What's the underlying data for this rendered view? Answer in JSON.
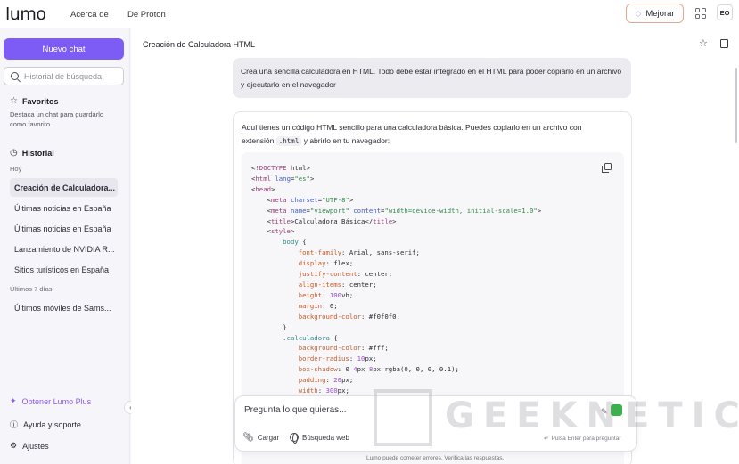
{
  "header": {
    "logo": "lumo",
    "nav": [
      "Acerca de",
      "De Proton"
    ],
    "upgrade_label": "Mejorar",
    "avatar_initials": "EO"
  },
  "sidebar": {
    "new_chat_label": "Nuevo chat",
    "search_placeholder": "Historial de búsqueda",
    "favorites_title": "Favoritos",
    "favorites_desc": "Destaca un chat para guardarlo como favorito.",
    "history_title": "Historial",
    "groups": [
      {
        "label": "Hoy",
        "items": [
          "Creación de Calculadora...",
          "Últimas noticias en España",
          "Últimas noticias en España",
          "Lanzamiento de NVIDIA R...",
          "Sitios turísticos en España"
        ]
      },
      {
        "label": "Últimos 7 días",
        "items": [
          "Últimos móviles de Sams..."
        ]
      }
    ],
    "footer": {
      "plus_label": "Obtener Lumo Plus",
      "help_label": "Ayuda y soporte",
      "settings_label": "Ajustes"
    }
  },
  "chat": {
    "title": "Creación de Calculadora HTML",
    "user_message": "Crea una sencilla calculadora en HTML. Todo debe estar integrado en el HTML para poder copiarlo en un archivo y ejecutarlo en el navegador",
    "bot_intro_before": "Aquí tienes un código HTML sencillo para una calculadora básica. Puedes copiarlo en un archivo con extensión",
    "bot_intro_code": ".html",
    "bot_intro_after": "y abrirlo en tu navegador:",
    "code_lines": [
      "<!DOCTYPE html>",
      "<html lang=\"es\">",
      "<head>",
      "    <meta charset=\"UTF-8\">",
      "    <meta name=\"viewport\" content=\"width=device-width, initial-scale=1.0\">",
      "    <title>Calculadora Básica</title>",
      "    <style>",
      "        body {",
      "            font-family: Arial, sans-serif;",
      "            display: flex;",
      "            justify-content: center;",
      "            align-items: center;",
      "            height: 100vh;",
      "            margin: 0;",
      "            background-color: #f0f0f0;",
      "        }",
      "        .calculadora {",
      "            background-color: #fff;",
      "            border-radius: 10px;",
      "            box-shadow: 0 4px 8px rgba(0, 0, 0, 0.1);",
      "            padding: 20px;",
      "            width: 300px;"
    ]
  },
  "composer": {
    "placeholder": "Pregunta lo que quieras...",
    "attach_label": "Cargar",
    "web_search_label": "Búsqueda web",
    "enter_hint": "Pulsa Enter para preguntar"
  },
  "disclaimer": "Lumo puede cometer errores. Verifica las respuestas.",
  "watermark": {
    "box_letter": "E",
    "text": "GEEKNETIC"
  },
  "colors": {
    "accent": "#7c5cf5",
    "plus_text": "#8a5cf0",
    "send": "#3bb04c"
  }
}
